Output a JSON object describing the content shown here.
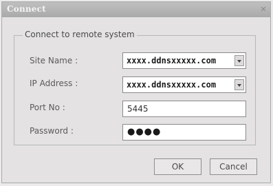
{
  "window": {
    "title": "Connect",
    "close_icon": "close-icon"
  },
  "group": {
    "legend": "Connect to remote system"
  },
  "fields": {
    "site_name": {
      "label": "Site Name :",
      "value": "xxxx.ddnsxxxxx.com"
    },
    "ip_address": {
      "label": "IP Address :",
      "value": "xxxx.ddnsxxxxx.com"
    },
    "port_no": {
      "label": "Port No :",
      "value": "5445"
    },
    "password": {
      "label": "Password :",
      "value": "●●●●"
    }
  },
  "buttons": {
    "ok": "OK",
    "cancel": "Cancel"
  }
}
